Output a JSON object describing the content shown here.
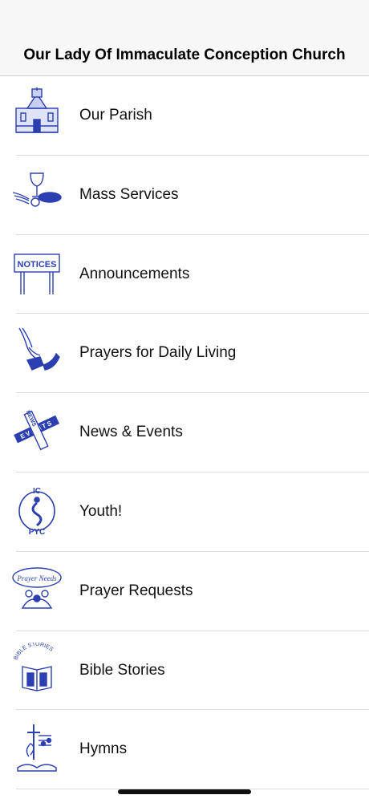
{
  "header": {
    "title": "Our Lady Of Immaculate Conception Church"
  },
  "menu": {
    "items": [
      {
        "label": "Our Parish",
        "icon": "church-icon"
      },
      {
        "label": "Mass Services",
        "icon": "chalice-bread-icon"
      },
      {
        "label": "Announcements",
        "icon": "notices-sign-icon"
      },
      {
        "label": "Prayers for Daily Living",
        "icon": "praying-hands-icon"
      },
      {
        "label": "News & Events",
        "icon": "news-events-crossword-icon"
      },
      {
        "label": "Youth!",
        "icon": "youth-pyc-icon"
      },
      {
        "label": "Prayer Requests",
        "icon": "prayer-needs-icon"
      },
      {
        "label": "Bible Stories",
        "icon": "bible-stories-icon"
      },
      {
        "label": "Hymns",
        "icon": "hymns-icon"
      }
    ],
    "icon_texts": {
      "notices": "NOTICES",
      "news": "NEWS",
      "events": "EVENTS",
      "ic": "IC",
      "pyc": "PYC",
      "prayer_needs": "Prayer Needs",
      "bible_stories": "BIBLE STORIES"
    }
  },
  "colors": {
    "icon_blue": "#2b3fb0",
    "separator": "#dcdcdc"
  }
}
